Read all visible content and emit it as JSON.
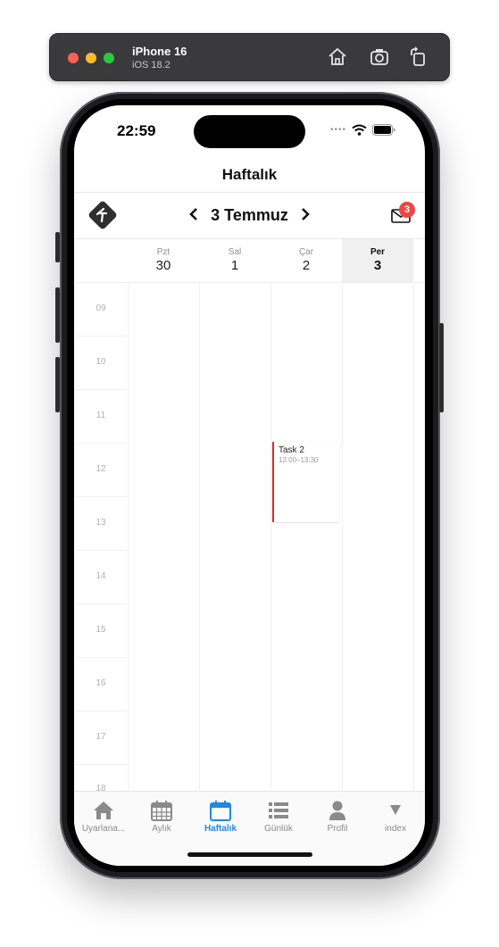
{
  "simulator": {
    "device": "iPhone 16",
    "os": "iOS 18.2"
  },
  "status_bar": {
    "time": "22:59"
  },
  "nav": {
    "title": "Haftalık"
  },
  "header": {
    "current_date": "3 Temmuz",
    "prev": "‹",
    "next": "›",
    "mail_badge": "3"
  },
  "week_days": [
    {
      "name": "Pzt",
      "num": "30"
    },
    {
      "name": "Sal",
      "num": "1"
    },
    {
      "name": "Çar",
      "num": "2"
    },
    {
      "name": "Per",
      "num": "3"
    }
  ],
  "hours": [
    "09",
    "10",
    "11",
    "12",
    "13",
    "14",
    "15",
    "16",
    "17",
    "18"
  ],
  "events": [
    {
      "title": "Task 2",
      "time": "12:00–13:30",
      "color": "#d32f2f"
    }
  ],
  "tabs": [
    {
      "label": "Uyarlana...",
      "icon": "home-icon"
    },
    {
      "label": "Aylık",
      "icon": "calendar-month-icon"
    },
    {
      "label": "Haftalık",
      "icon": "calendar-week-icon",
      "active": true
    },
    {
      "label": "Günlük",
      "icon": "list-icon"
    },
    {
      "label": "Profil",
      "icon": "person-icon"
    },
    {
      "label": "index",
      "icon": "triangle-down-icon"
    }
  ],
  "colors": {
    "accent": "#1e88e5",
    "badge": "#ef4444",
    "event_border": "#d32f2f"
  }
}
